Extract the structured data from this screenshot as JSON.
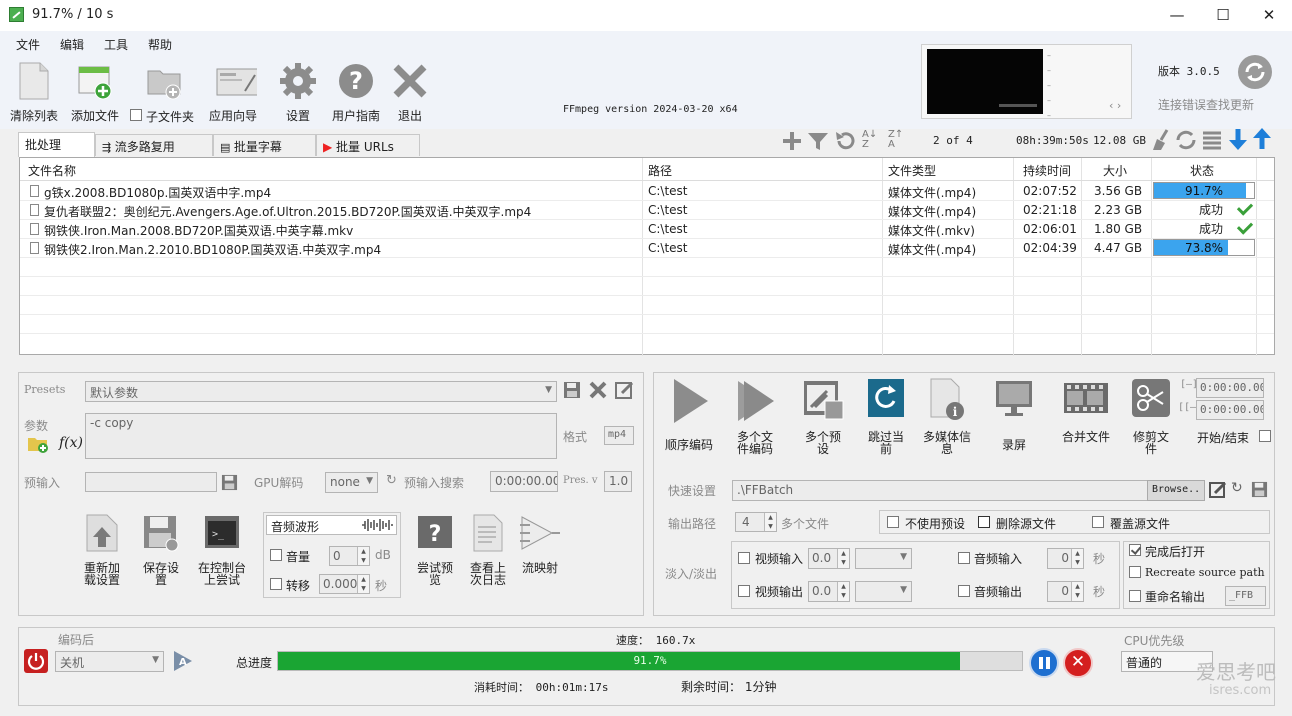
{
  "window": {
    "title": "91.7% / 10 s",
    "minimize": "—",
    "maximize": "☐",
    "close": "✕"
  },
  "menu": [
    "文件",
    "编辑",
    "工具",
    "帮助"
  ],
  "toolbar": {
    "clear": "清除列表",
    "add_file": "添加文件",
    "subfolder": "子文件夹",
    "wizard": "应用向导",
    "settings": "设置",
    "guide": "用户指南",
    "exit": "退出"
  },
  "ffmpeg_version": "FFmpeg version 2024-03-20 x64",
  "version": {
    "label": "版本 3.0.5",
    "update_hint": "连接错误查找更新"
  },
  "tabs": [
    "批处理",
    "流多路复用",
    "批量字幕",
    "批量 URLs"
  ],
  "list_tools": {
    "page": "2 of 4",
    "total_duration": "08h:39m:50s",
    "total_size": "12.08 GB"
  },
  "table": {
    "headers": [
      "文件名称",
      "路径",
      "文件类型",
      "持续时间",
      "大小",
      "状态"
    ],
    "rows": [
      {
        "name": "g铁x.2008.BD1080p.国英双语中字.mp4",
        "path": "C:\\test",
        "type": "媒体文件(.mp4)",
        "duration": "02:07:52",
        "size": "3.56 GB",
        "status": "91.7%",
        "progress": 0.917,
        "done": false
      },
      {
        "name": "复仇者联盟2：奥创纪元.Avengers.Age.of.Ultron.2015.BD720P.国英双语.中英双字.mp4",
        "path": "C:\\test",
        "type": "媒体文件(.mp4)",
        "duration": "02:21:18",
        "size": "2.23 GB",
        "status": "成功",
        "progress": 1,
        "done": true
      },
      {
        "name": "钢铁侠.Iron.Man.2008.BD720P.国英双语.中英字幕.mkv",
        "path": "C:\\test",
        "type": "媒体文件(.mkv)",
        "duration": "02:06:01",
        "size": "1.80 GB",
        "status": "成功",
        "progress": 1,
        "done": true
      },
      {
        "name": "钢铁侠2.Iron.Man.2.2010.BD1080P.国英双语.中英双字.mp4",
        "path": "C:\\test",
        "type": "媒体文件(.mp4)",
        "duration": "02:04:39",
        "size": "4.47 GB",
        "status": "73.8%",
        "progress": 0.738,
        "done": false
      }
    ]
  },
  "left_panel": {
    "presets_label": "Presets",
    "presets_value": "默认参数",
    "params_label": "参数",
    "params_value": "-c copy",
    "format_label": "格式",
    "format_value": "mp4",
    "preinput_label": "预输入",
    "gpu_label": "GPU解码",
    "gpu_value": "none",
    "preinput_search": "预输入搜索",
    "preinput_time": "0:00:00.000",
    "pres_label": "Pres. v",
    "pres_value": "1.0",
    "reload": "重新加载设置",
    "save_settings": "保存设置",
    "console": "在控制台上尝试",
    "waveform": "音频波形",
    "volume": "音量",
    "volume_value": "0",
    "db": "dB",
    "shift": "转移",
    "shift_value": "0.000",
    "sec": "秒",
    "try_preview": "尝试预览",
    "last_log": "查看上次日志",
    "stream_map": "流映射"
  },
  "right_panel": {
    "seq_encode": "顺序编码",
    "multi_encode": "多个文件编码",
    "multi_preview": "多个预设",
    "skip_current": "跳过当前",
    "media_info": "多媒体信息",
    "record": "录屏",
    "merge": "合并文件",
    "cut": "修剪文件",
    "start_end": "开始/结束",
    "time_start": "0:00:00.000",
    "time_end": "0:00:00.000",
    "quick_settings": "快速设置",
    "output_dir": ".\\FFBatch",
    "browse": "Browse..",
    "output_path": "输出路径",
    "multi_count": "4",
    "multi_files": "多个文件",
    "no_preset": "不使用预设",
    "delete_source": "删除源文件",
    "overwrite_source": "覆盖源文件",
    "fade": "淡入/淡出",
    "video_in": "视频输入",
    "video_in_value": "0.0",
    "video_out": "视频输出",
    "video_out_value": "0.0",
    "audio_in": "音频输入",
    "audio_in_value": "0",
    "audio_out": "音频输出",
    "audio_out_value": "0",
    "sec": "秒",
    "open_after": "完成后打开",
    "recreate_path": "Recreate source path",
    "rename_output": "重命名输出",
    "rename_suffix": "_FFB"
  },
  "bottom": {
    "after_encode": "编码后",
    "shutdown": "关机",
    "speed": "速度： 160.7x",
    "total_progress": "总进度",
    "progress": 0.917,
    "progress_text": "91.7%",
    "elapsed": "消耗时间： 00h:01m:17s",
    "remaining": "剩余时间： 1分钟",
    "cpu_priority": "CPU优先级",
    "priority_value": "普通的"
  },
  "watermark": {
    "line1": "爱思考吧",
    "line2": "isres.com"
  }
}
